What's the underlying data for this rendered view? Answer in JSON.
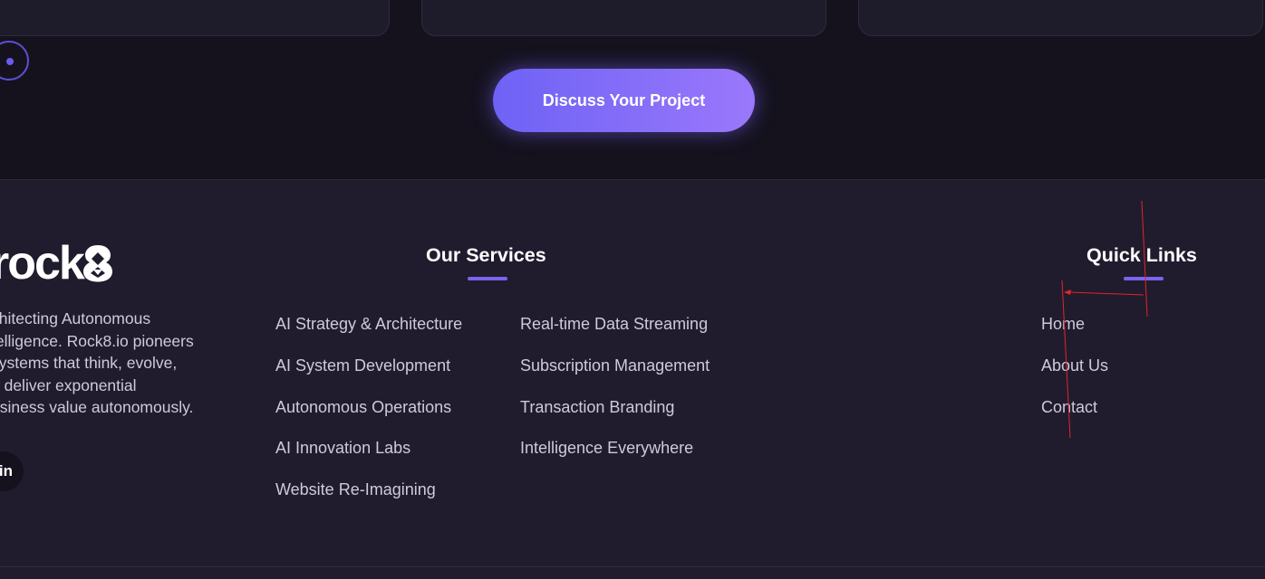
{
  "cta": {
    "label": "Discuss Your Project"
  },
  "brand": {
    "logo_text": "rock",
    "description": "chitecting Autonomous\ntelligence. Rock8.io pioneers\n systems that think, evolve,\nd deliver exponential\nusiness value autonomously."
  },
  "social": {
    "linkedin_label": "in"
  },
  "services": {
    "heading": "Our Services",
    "col1": [
      "AI Strategy & Architecture",
      "AI System Development",
      "Autonomous Operations",
      "AI Innovation Labs",
      "Website Re-Imagining"
    ],
    "col2": [
      "Real-time Data Streaming",
      "Subscription Management",
      "Transaction Branding",
      "Intelligence Everywhere"
    ]
  },
  "quick_links": {
    "heading": "Quick Links",
    "items": [
      "Home",
      "About Us",
      "Contact"
    ]
  },
  "colors": {
    "accent": "#7b62f0",
    "annotation": "#e0262c",
    "background": "#201c2d",
    "top_background": "#15121e"
  },
  "icons": {
    "linkedin": "linkedin-icon",
    "logo_mark": "rock8-eight-mark",
    "carousel_dot": "carousel-dot-icon"
  }
}
